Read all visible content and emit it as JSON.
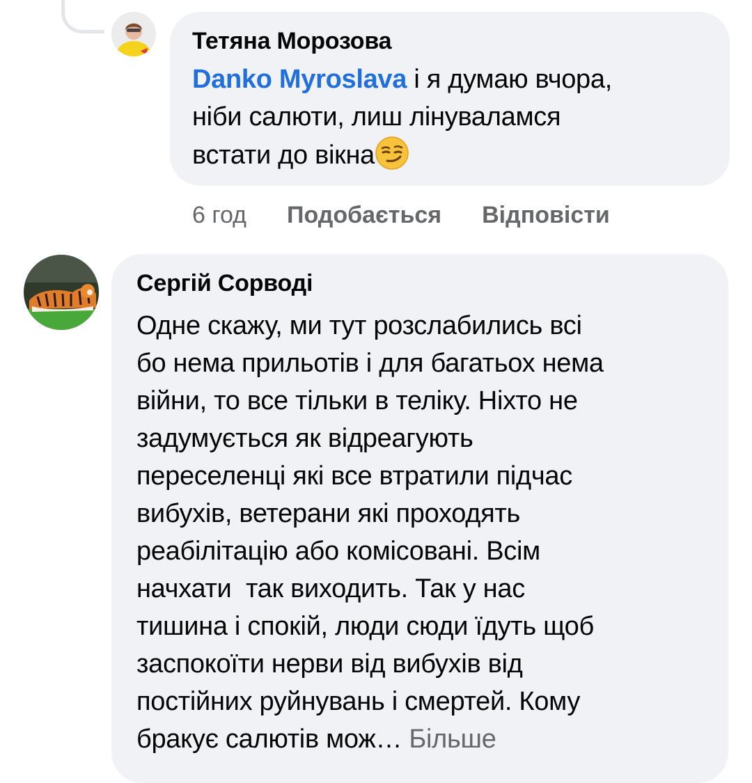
{
  "comments": [
    {
      "author": "Тетяна Морозова",
      "mention": "Danko Myroslava",
      "text_line1": " і я думаю вчора,",
      "text_line2": "ніби салюти, лиш лінуваламся",
      "text_line3": "встати до вікна",
      "emoji": "smirking-face",
      "time": "6 год",
      "like_label": "Подобається",
      "reply_label": "Відповісти"
    },
    {
      "author": "Сергій Сорводі",
      "lines": [
        "Одне скажу, ми тут розслабились всі",
        "бо нема прильотів і для багатьох нема",
        "війни, то все тільки в теліку. Ніхто не",
        "задумується як відреагують",
        "переселенці які все втратили підчас",
        "вибухів, ветерани які проходять",
        "реабілітацію або комісовані. Всім",
        "начхати  так виходить. Так у нас",
        "тишина і спокій, люди сюди їдуть щоб",
        "заспокоїти нерви від вибухів від",
        "постійних руйнувань і смертей. Кому",
        "бракує салютів мож… "
      ],
      "more_label": "Більше"
    }
  ],
  "colors": {
    "bubble": "#f0f2f5",
    "link": "#216fdb",
    "meta": "#65676b",
    "text": "#050505"
  }
}
